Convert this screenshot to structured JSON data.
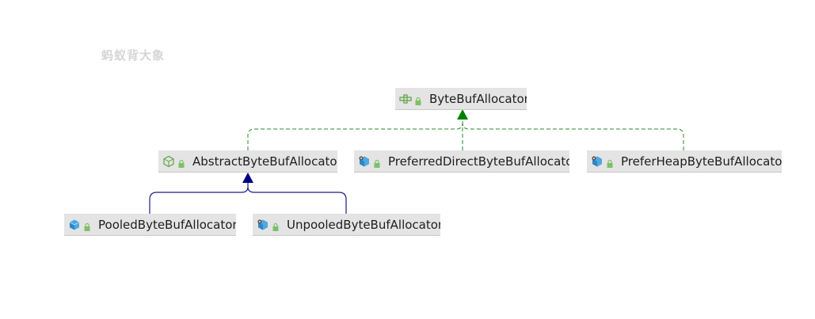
{
  "watermark": "蚂蚁背大象",
  "nodes": {
    "byte_buf_allocator": {
      "label": "ByteBufAllocator",
      "kind": "interface"
    },
    "abstract_byte_buf_allocator": {
      "label": "AbstractByteBufAllocator",
      "kind": "abstract-class"
    },
    "preferred_direct_byte_buf_allocator": {
      "label": "PreferredDirectByteBufAllocato",
      "kind": "class"
    },
    "prefer_heap_byte_buf_allocator": {
      "label": "PreferHeapByteBufAllocator",
      "kind": "class"
    },
    "pooled_byte_buf_allocator": {
      "label": "PooledByteBufAllocator",
      "kind": "class"
    },
    "unpooled_byte_buf_allocator": {
      "label": "UnpooledByteBufAllocator",
      "kind": "class"
    }
  },
  "relations": [
    {
      "from": "abstract_byte_buf_allocator",
      "to": "byte_buf_allocator",
      "type": "implements",
      "color": "#2a8a2a"
    },
    {
      "from": "preferred_direct_byte_buf_allocator",
      "to": "byte_buf_allocator",
      "type": "implements",
      "color": "#2a8a2a"
    },
    {
      "from": "prefer_heap_byte_buf_allocator",
      "to": "byte_buf_allocator",
      "type": "implements",
      "color": "#2a8a2a"
    },
    {
      "from": "pooled_byte_buf_allocator",
      "to": "abstract_byte_buf_allocator",
      "type": "extends",
      "color": "#1a1a8c"
    },
    {
      "from": "unpooled_byte_buf_allocator",
      "to": "abstract_byte_buf_allocator",
      "type": "extends",
      "color": "#1a1a8c"
    }
  ],
  "colors": {
    "implements_edge": "#2a8a2a",
    "extends_edge": "#1a1a8c",
    "node_bg": "#e4e4e4",
    "class_icon": "#4fa8e0",
    "interface_icon": "#6aa84f",
    "lock_icon": "#7ec06a"
  }
}
